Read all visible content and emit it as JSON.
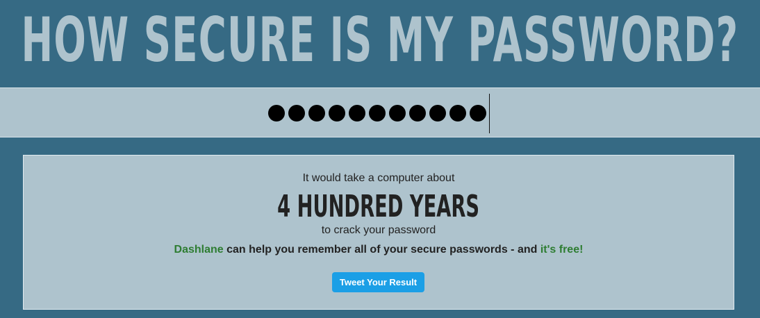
{
  "header": {
    "title": "HOW SECURE IS MY PASSWORD?"
  },
  "password_field": {
    "masked_char_count": 11
  },
  "result": {
    "intro": "It would take a computer about",
    "time": "4 HUNDRED YEARS",
    "outro": "to crack your password",
    "promo": {
      "brand": "Dashlane",
      "middle": " can help you remember all of your secure passwords - and ",
      "free": "it's free!"
    },
    "tweet_button": "Tweet Your Result"
  },
  "colors": {
    "background": "#366a84",
    "panel": "#aec3cd",
    "brand_green": "#2e7d32",
    "button_blue": "#1b9fe6"
  }
}
